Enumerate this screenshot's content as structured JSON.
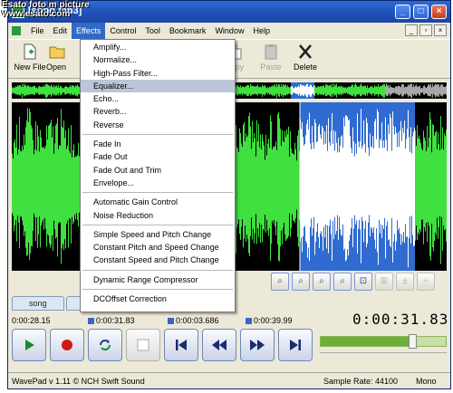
{
  "watermark": {
    "line1": "Esato foto m picture",
    "line2": "www.esato.com"
  },
  "window": {
    "title": "[song.mp3]",
    "buttons": [
      "_",
      "□",
      "×"
    ]
  },
  "menubar": {
    "items": [
      "File",
      "Edit",
      "Effects",
      "Control",
      "Tool",
      "Bookmark",
      "Window",
      "Help"
    ],
    "active": "Effects"
  },
  "toolbar": {
    "new_file": "New File",
    "open": "Open",
    "copy": "py",
    "paste": "Paste",
    "delete": "Delete"
  },
  "effects_menu": {
    "groups": [
      [
        "Amplify...",
        "Normalize...",
        "High-Pass Filter...",
        "Equalizer...",
        "Echo...",
        "Reverb...",
        "Reverse"
      ],
      [
        "Fade In",
        "Fade Out",
        "Fade Out and Trim",
        "Envelope..."
      ],
      [
        "Automatic Gain Control",
        "Noise Reduction"
      ],
      [
        "Simple Speed and Pitch Change",
        "Constant Pitch and Speed Change",
        "Constant Speed and Pitch Change"
      ],
      [
        "Dynamic Range Compressor"
      ],
      [
        "DCOffset Correction"
      ]
    ],
    "highlighted": "Equalizer..."
  },
  "tabs": [
    "song",
    ""
  ],
  "times": {
    "position": "0:00:28.15",
    "sel_start": "0:00:31.83",
    "sel_length": "0:00:03.686",
    "end": "0:00:39.99",
    "current": "0:00:31.83"
  },
  "volume": {
    "level": 0.73
  },
  "status": {
    "app": "WavePad v 1.11 © NCH Swift Sound",
    "sample_rate": "Sample Rate: 44100",
    "channels": "Mono"
  },
  "colors": {
    "wave": "#3fe03f",
    "wave_selected": "#ffffff",
    "selection_bg": "#2f6bd0",
    "wave_bg": "#000000",
    "titlebar": "#2e6ad8"
  },
  "icons": {
    "new_file": "new-file-icon",
    "open": "open-folder-icon",
    "copy": "copy-icon",
    "paste": "paste-icon",
    "delete": "delete-x-icon",
    "zoom": [
      "zoom-out-icon",
      "zoom-in-icon",
      "zoom-selection-icon",
      "zoom-full-icon",
      "zoom-fit-icon",
      "vertical-zoom-in-icon",
      "vertical-zoom-out-icon"
    ],
    "transport": [
      "play-icon",
      "record-icon",
      "loop-icon",
      "stop-icon",
      "go-start-icon",
      "rewind-icon",
      "fast-forward-icon",
      "go-end-icon"
    ]
  }
}
